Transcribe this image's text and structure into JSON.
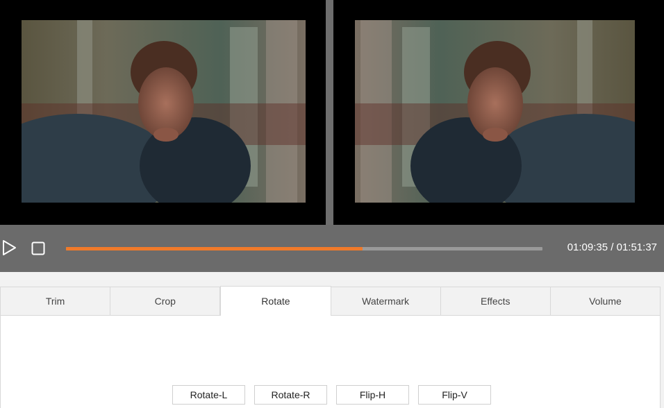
{
  "player": {
    "time_current": "01:09:35",
    "time_separator": " / ",
    "time_total": "01:51:37",
    "progress": 0.622
  },
  "tabs": [
    {
      "label": "Trim"
    },
    {
      "label": "Crop"
    },
    {
      "label": "Rotate"
    },
    {
      "label": "Watermark"
    },
    {
      "label": "Effects"
    },
    {
      "label": "Volume"
    }
  ],
  "active_tab": "Rotate",
  "rotate_panel": {
    "buttons": [
      {
        "label": "Rotate-L"
      },
      {
        "label": "Rotate-R"
      },
      {
        "label": "Flip-H"
      },
      {
        "label": "Flip-V"
      }
    ]
  },
  "colors": {
    "accent": "#f07a2a",
    "control_bar": "#6b6b6b",
    "track": "#9a9a9a"
  },
  "icons": {
    "play": "play-icon",
    "stop": "stop-icon"
  }
}
